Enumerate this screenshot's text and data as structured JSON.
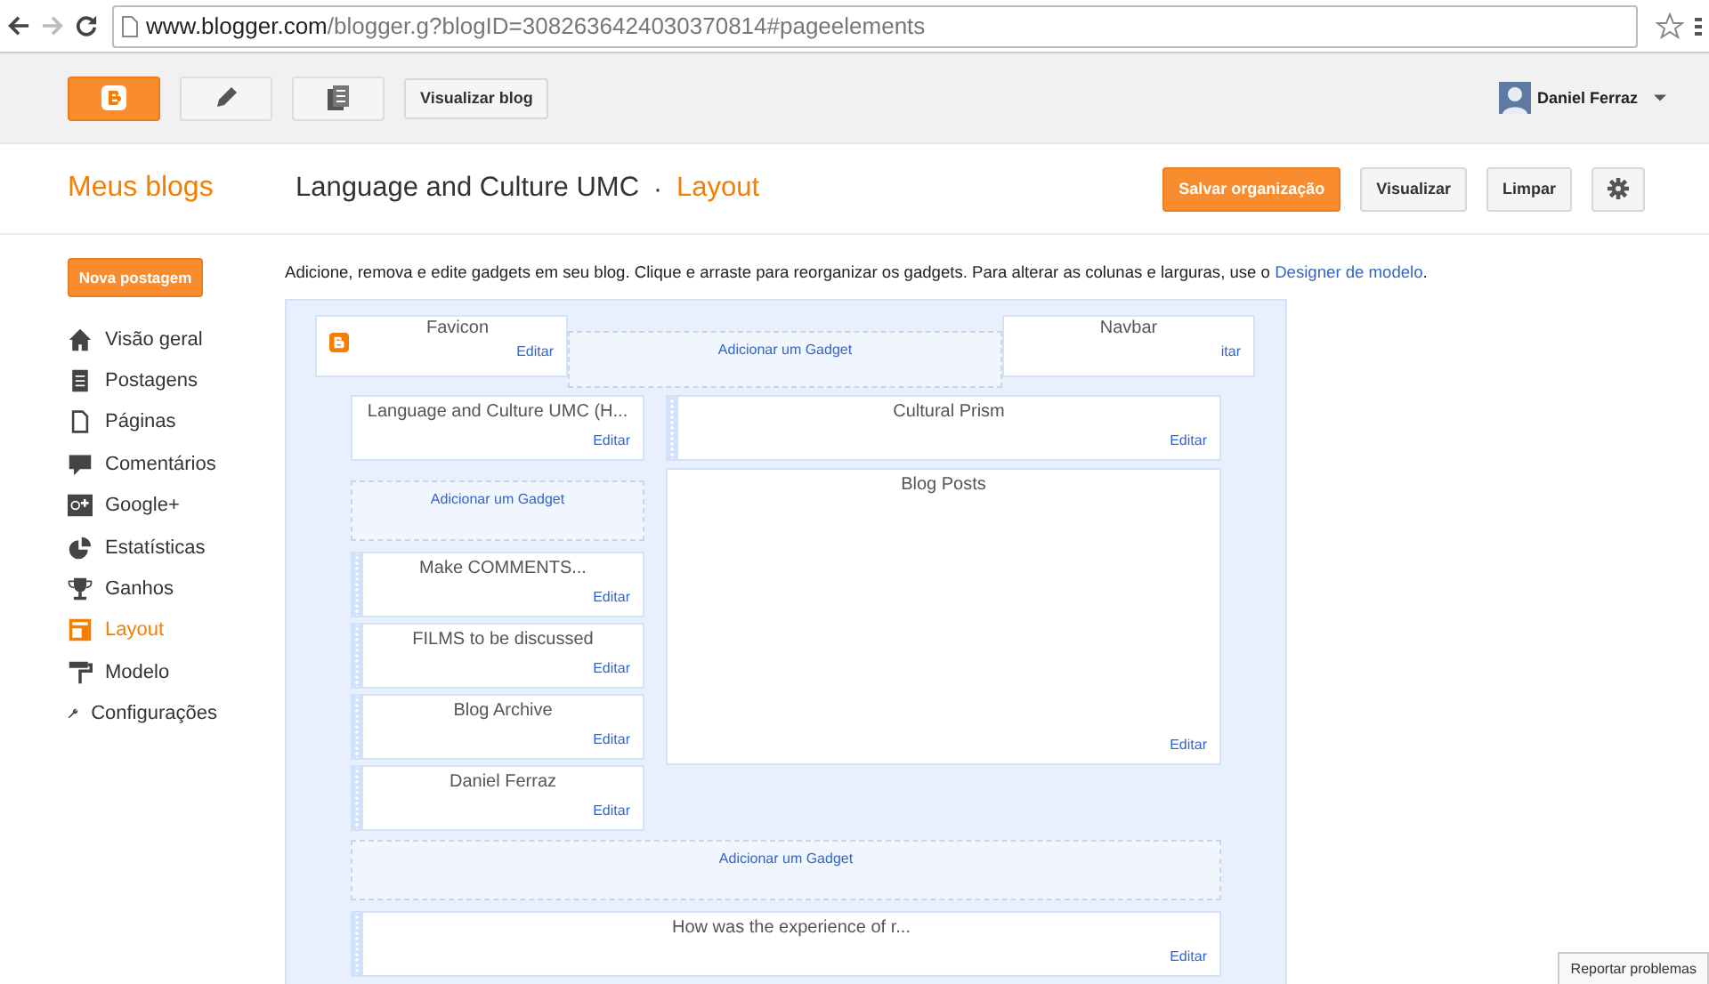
{
  "browser": {
    "url_host": "www.blogger.com",
    "url_path": "/blogger.g?blogID=3082636424030370814#pageelements"
  },
  "topbar": {
    "apps": [
      {
        "kind": "blogger",
        "selected": true
      },
      {
        "kind": "pencil",
        "selected": false
      },
      {
        "kind": "pages",
        "selected": false
      }
    ],
    "view_blog": "Visualizar blog",
    "user": "Daniel Ferraz"
  },
  "header": {
    "my_blogs": "Meus blogs",
    "blog_title": "Language and Culture UMC",
    "separator": "·",
    "section": "Layout",
    "actions": [
      {
        "kind": "primary",
        "label": "Salvar organização"
      },
      {
        "kind": "default",
        "label": "Visualizar"
      },
      {
        "kind": "default",
        "label": "Limpar"
      },
      {
        "kind": "settings"
      }
    ]
  },
  "sidebar": {
    "new_post": "Nova postagem",
    "items": [
      {
        "label": "Visão geral",
        "selected": false
      },
      {
        "label": "Postagens",
        "selected": false
      },
      {
        "label": "Páginas",
        "selected": false
      },
      {
        "label": "Comentários",
        "selected": false
      },
      {
        "label": "Google+",
        "selected": false
      },
      {
        "label": "Estatísticas",
        "selected": false
      },
      {
        "label": "Ganhos",
        "selected": false
      },
      {
        "label": "Layout",
        "selected": true
      },
      {
        "label": "Modelo",
        "selected": false
      },
      {
        "label": "Configurações",
        "selected": false
      }
    ]
  },
  "intro": {
    "text": "Adicione, remova e edite gadgets em seu blog. Clique e arraste para reorganizar os gadgets. Para alterar as colunas e larguras, use o",
    "link": "Designer de modelo",
    "end": "."
  },
  "layout": {
    "header_gadgets": [
      {
        "title": "Favicon",
        "edit": "Editar",
        "logo": true
      },
      {
        "title": "Navbar",
        "edit": "itar",
        "logo": false
      }
    ],
    "header_add": "Adicionar um Gadget",
    "sidebar_column": [
      {
        "kind": "gadget",
        "title": "Language and Culture UMC (H...",
        "edit": "Editar",
        "draggable": false
      },
      {
        "kind": "add",
        "label": "Adicionar um Gadget"
      },
      {
        "kind": "gadget",
        "title": "Make COMMENTS...",
        "edit": "Editar",
        "draggable": true
      },
      {
        "kind": "gadget",
        "title": "FILMS to be discussed",
        "edit": "Editar",
        "draggable": true
      },
      {
        "kind": "gadget",
        "title": "Blog Archive",
        "edit": "Editar",
        "draggable": true
      },
      {
        "kind": "gadget",
        "title": "Daniel Ferraz",
        "edit": "Editar",
        "draggable": true
      }
    ],
    "main_column": [
      {
        "kind": "gadget",
        "title": "Cultural Prism",
        "edit": "Editar",
        "draggable": true
      },
      {
        "kind": "posts",
        "title": "Blog Posts",
        "edit": "Editar",
        "draggable": false
      }
    ],
    "footer": [
      {
        "kind": "add",
        "label": "Adicionar um Gadget"
      },
      {
        "kind": "gadget",
        "title": "How was the experience of r...",
        "edit": "Editar",
        "draggable": true
      }
    ]
  },
  "report": "Reportar problemas"
}
